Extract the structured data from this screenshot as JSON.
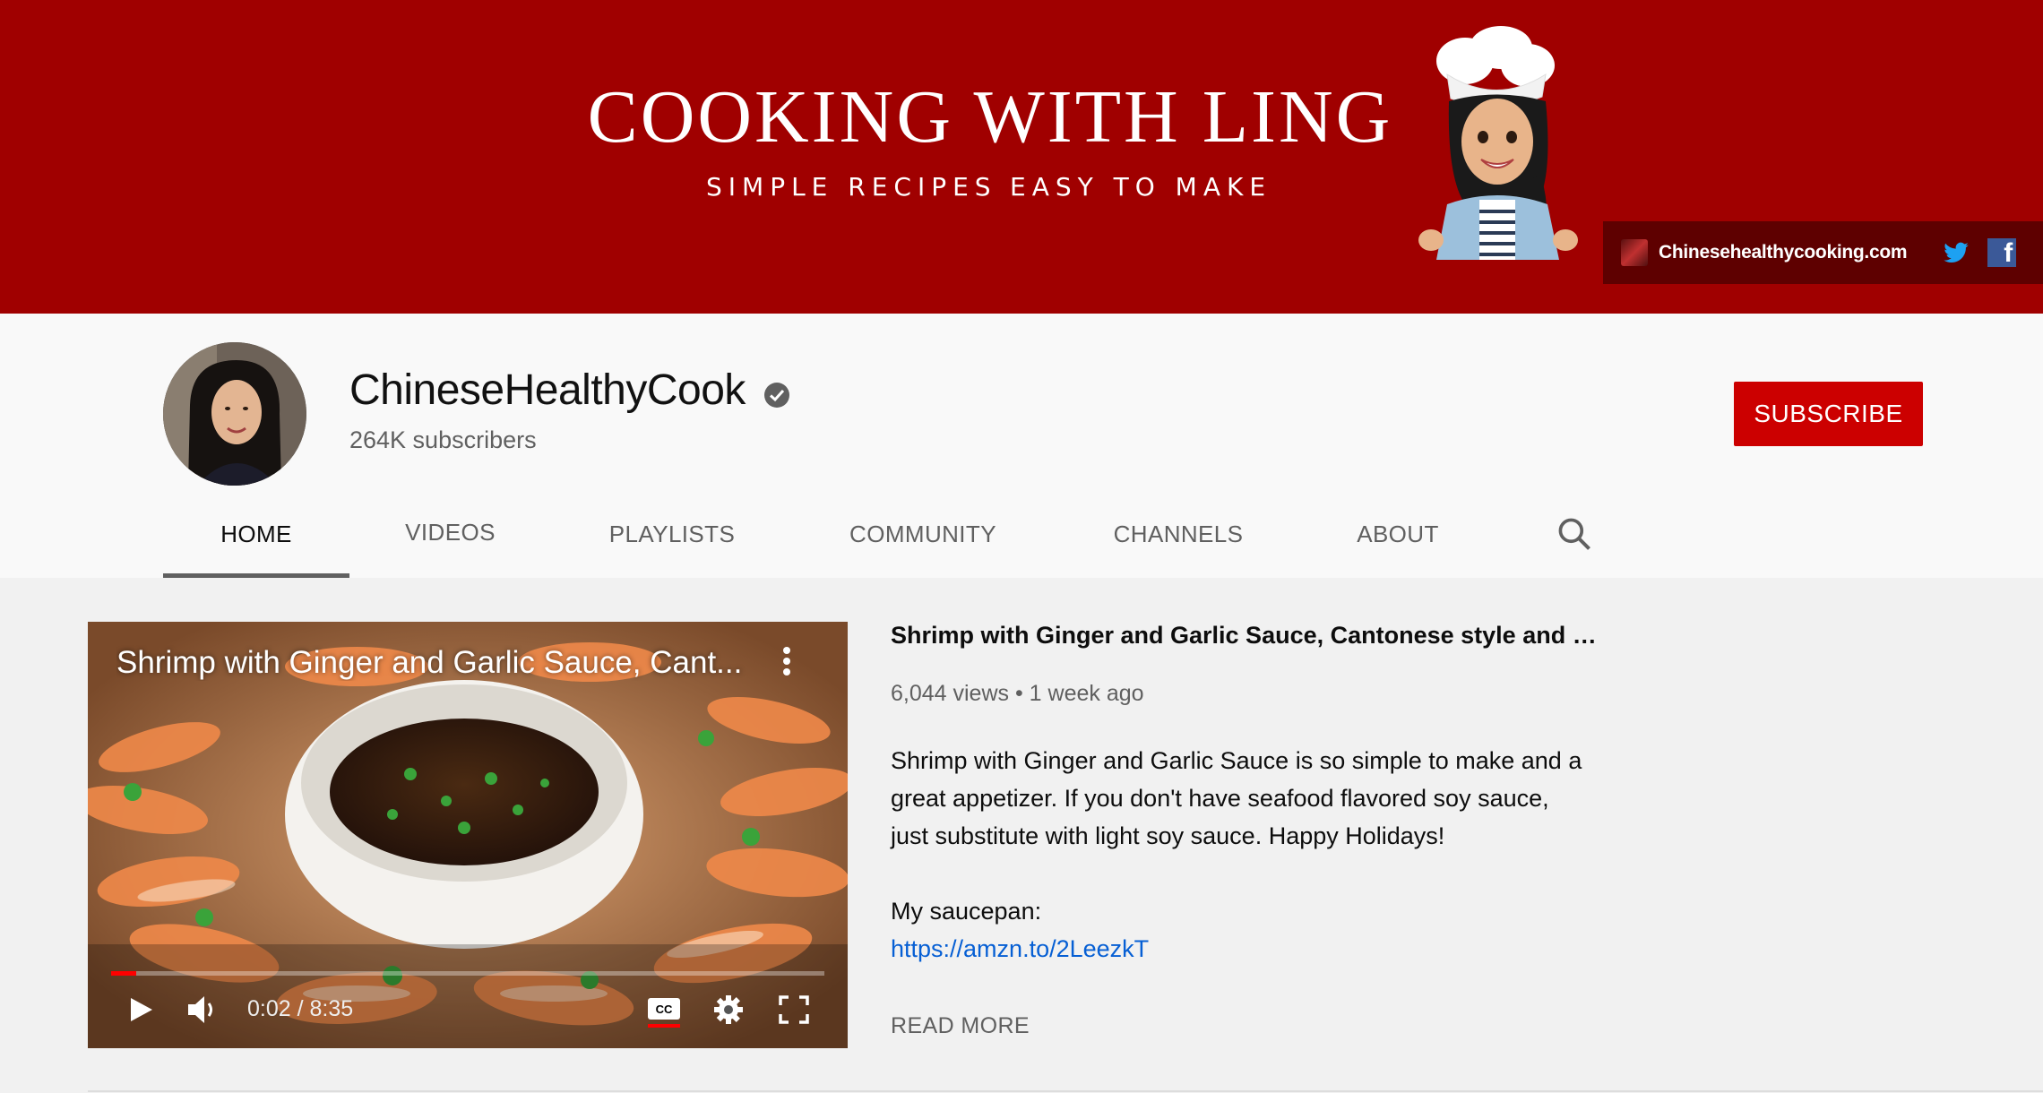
{
  "banner": {
    "title": "COOKING WITH LING",
    "tagline_1": "SIMPLE RECIPES",
    "tagline_2": "EASY TO MAKE",
    "link_text": "Chinesehealthycooking.com",
    "social_icons": [
      "twitter-icon",
      "facebook-icon"
    ],
    "bg_color": "#a00000"
  },
  "channel": {
    "name": "ChineseHealthyCook",
    "subscribers": "264K subscribers",
    "verified": true,
    "subscribe_label": "SUBSCRIBE",
    "subscribe_color": "#cc0000"
  },
  "tabs": [
    {
      "label": "HOME",
      "active": true
    },
    {
      "label": "VIDEOS",
      "active": false
    },
    {
      "label": "PLAYLISTS",
      "active": false
    },
    {
      "label": "COMMUNITY",
      "active": false
    },
    {
      "label": "CHANNELS",
      "active": false
    },
    {
      "label": "ABOUT",
      "active": false
    }
  ],
  "featured_video": {
    "player_title": "Shrimp with Ginger and Garlic Sauce, Cant...",
    "time": "0:02 / 8:35",
    "progress": 0.004,
    "title": "Shrimp with Ginger and Garlic Sauce, Cantonese style and a gr...",
    "meta": "6,044 views • 1 week ago",
    "description_lines": [
      "Shrimp with Ginger and Garlic Sauce is so simple to make and a",
      "great appetizer. If you don't have seafood flavored soy sauce,",
      "just substitute with light soy sauce. Happy Holidays!"
    ],
    "saucepan_label": "My saucepan:",
    "link": "https://amzn.to/2LeezkT",
    "read_more": "READ MORE"
  }
}
